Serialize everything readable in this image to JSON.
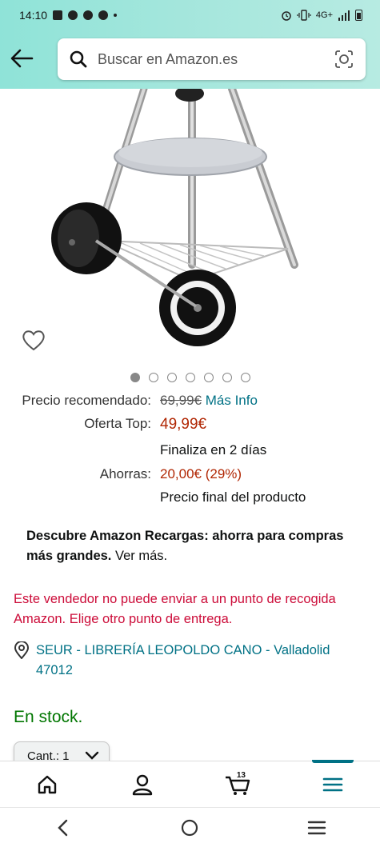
{
  "status_bar": {
    "time": "14:10",
    "network": "4G+"
  },
  "search": {
    "placeholder": "Buscar en Amazon.es"
  },
  "carousel": {
    "total_images": 7,
    "active_index": 0
  },
  "price": {
    "recommended_label": "Precio recomendado:",
    "recommended_value": "69,99€",
    "more_info_link": "Más Info",
    "offer_label": "Oferta Top:",
    "offer_value": "49,99€",
    "ends_text": "Finaliza en 2 días",
    "savings_label": "Ahorras:",
    "savings_value": "20,00€ (29%)",
    "final_price_text": "Precio final del producto"
  },
  "promo": {
    "bold_text": "Descubre Amazon Recargas: ahorra para compras más grandes.",
    "link_text": " Ver más."
  },
  "warning": {
    "text": "Este vendedor no puede enviar a un punto de recogida Amazon. Elige otro punto de entrega."
  },
  "pickup": {
    "location": "SEUR - LIBRERÍA LEOPOLDO CANO - Valladolid 47012"
  },
  "stock": {
    "status": "En stock."
  },
  "quantity": {
    "label": "Cant.: 1"
  },
  "bottom_nav": {
    "cart_count": "13",
    "items": [
      "home-icon",
      "account-icon",
      "cart-icon",
      "menu-icon"
    ],
    "active": "menu"
  },
  "colors": {
    "accent_teal": "#007185",
    "price_red": "#b12704",
    "warning_red": "#cc0c39",
    "stock_green": "#007600"
  }
}
